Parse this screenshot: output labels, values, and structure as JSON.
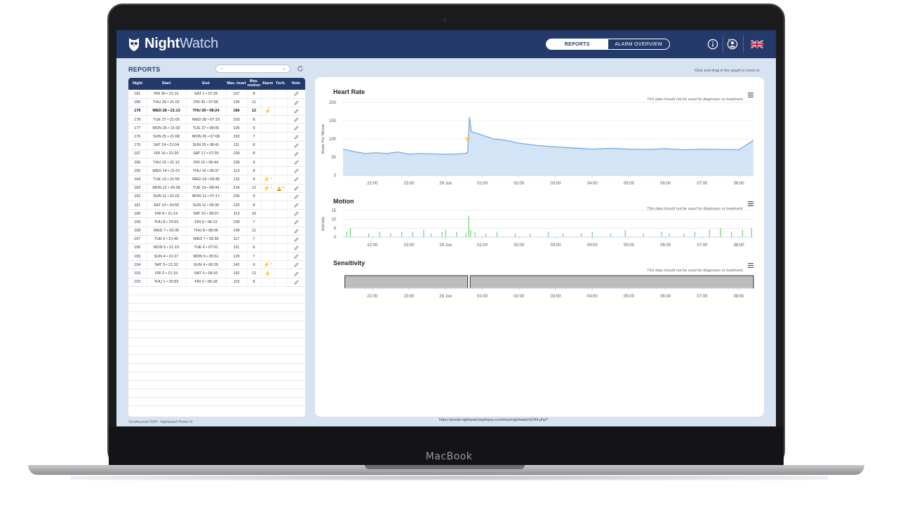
{
  "device": {
    "brand_label": "MacBook"
  },
  "app": {
    "logo_bold": "Night",
    "logo_thin": "Watch",
    "nav": {
      "reports": "REPORTS",
      "alarm_overview": "ALARM OVERVIEW",
      "active": "reports"
    },
    "icons": [
      "info-icon",
      "user-icon",
      "uk-flag-icon"
    ]
  },
  "reports": {
    "title": "REPORTS",
    "select_value": "",
    "columns": [
      "Night",
      "Start",
      "End",
      "Max. heart",
      "Max. motion",
      "Alarm",
      "Tech.",
      "Note"
    ],
    "rows": [
      {
        "night": "181",
        "start": "FRI 30 • 21:10",
        "end": "SAT 1 • 07:25",
        "heart": "107",
        "motion": "8",
        "alarm": "",
        "tech": "",
        "bold": false
      },
      {
        "night": "180",
        "start": "THU 29 • 21:02",
        "end": "FRI 30 • 07:56",
        "heart": "125",
        "motion": "11",
        "alarm": "",
        "tech": "",
        "bold": false
      },
      {
        "night": "179",
        "start": "WED 28 • 21:13",
        "end": "THU 29 • 08:24",
        "heart": "166",
        "motion": "12",
        "alarm": "⚡",
        "alarm_count": "",
        "tech": "",
        "bold": true
      },
      {
        "night": "178",
        "start": "TUE 27 • 21:03",
        "end": "WED 28 • 07:19",
        "heart": "103",
        "motion": "8",
        "alarm": "",
        "tech": "",
        "bold": false
      },
      {
        "night": "177",
        "start": "MON 26 • 21:02",
        "end": "TUE 27 • 08:06",
        "heart": "105",
        "motion": "9",
        "alarm": "",
        "tech": "",
        "bold": false
      },
      {
        "night": "176",
        "start": "SUN 25 • 21:08",
        "end": "MON 26 • 07:08",
        "heart": "103",
        "motion": "7",
        "alarm": "",
        "tech": "",
        "bold": false
      },
      {
        "night": "175",
        "start": "SAT 24 • 21:04",
        "end": "SUN 25 • 08:41",
        "heart": "111",
        "motion": "8",
        "alarm": "",
        "tech": "",
        "bold": false
      },
      {
        "night": "167",
        "start": "FRI 16 • 21:20",
        "end": "SAT 17 • 07:26",
        "heart": "109",
        "motion": "8",
        "alarm": "",
        "tech": "",
        "bold": false
      },
      {
        "night": "166",
        "start": "THU 15 • 21:12",
        "end": "FRI 16 • 06:44",
        "heart": "109",
        "motion": "9",
        "alarm": "",
        "tech": "",
        "bold": false
      },
      {
        "night": "165",
        "start": "WED 14 • 21:01",
        "end": "THU 15 • 06:37",
        "heart": "113",
        "motion": "8",
        "alarm": "",
        "tech": "",
        "bold": false
      },
      {
        "night": "164",
        "start": "TUE 13 • 21:59",
        "end": "WED 14 • 09:45",
        "heart": "122",
        "motion": "9",
        "alarm": "⚡",
        "alarm_count": "1",
        "tech": "",
        "bold": false
      },
      {
        "night": "163",
        "start": "MON 12 • 20:28",
        "end": "TUE 13 • 08:44",
        "heart": "214",
        "motion": "12",
        "alarm": "⚡",
        "alarm_count": "2",
        "tech": "🔔",
        "tech_count": "12",
        "bold": false
      },
      {
        "night": "162",
        "start": "SUN 11 • 21:02",
        "end": "MON 12 • 07:17",
        "heart": "105",
        "motion": "9",
        "alarm": "",
        "tech": "",
        "bold": false
      },
      {
        "night": "161",
        "start": "SAT 10 • 20:55",
        "end": "SUN 11 • 06:30",
        "heart": "120",
        "motion": "8",
        "alarm": "",
        "tech": "",
        "bold": false
      },
      {
        "night": "160",
        "start": "FRI 9 • 21:14",
        "end": "SAT 10 • 08:07",
        "heart": "113",
        "motion": "10",
        "alarm": "",
        "tech": "",
        "bold": false
      },
      {
        "night": "159",
        "start": "THU 8 • 20:53",
        "end": "FRI 9 • 06:13",
        "heart": "109",
        "motion": "7",
        "alarm": "",
        "tech": "",
        "bold": false
      },
      {
        "night": "158",
        "start": "WED 7 • 20:35",
        "end": "THU 8 • 08:06",
        "heart": "109",
        "motion": "11",
        "alarm": "",
        "tech": "",
        "bold": false
      },
      {
        "night": "157",
        "start": "TUE 6 • 21:40",
        "end": "WED 7 • 06:36",
        "heart": "117",
        "motion": "7",
        "alarm": "",
        "tech": "",
        "bold": false
      },
      {
        "night": "156",
        "start": "MON 5 • 21:19",
        "end": "TUE 6 • 07:01",
        "heart": "111",
        "motion": "6",
        "alarm": "",
        "tech": "",
        "bold": false
      },
      {
        "night": "155",
        "start": "SUN 4 • 21:27",
        "end": "MON 5 • 05:51",
        "heart": "125",
        "motion": "7",
        "alarm": "",
        "tech": "",
        "bold": false
      },
      {
        "night": "154",
        "start": "SAT 3 • 21:32",
        "end": "SUN 4 • 06:29",
        "heart": "142",
        "motion": "9",
        "alarm": "⚡",
        "alarm_count": "1",
        "tech": "",
        "bold": false
      },
      {
        "night": "153",
        "start": "FRI 2 • 21:19",
        "end": "SAT 3 • 09:10",
        "heart": "162",
        "motion": "12",
        "alarm": "⚡",
        "alarm_count": "",
        "tech": "",
        "bold": false
      },
      {
        "night": "152",
        "start": "THU 1 • 20:53",
        "end": "FRI 2 • 06:18",
        "heart": "115",
        "motion": "9",
        "alarm": "",
        "tech": "",
        "bold": false
      }
    ],
    "empty_rows": 14
  },
  "footer": {
    "copyright": "©LivAssured 2024 - Nightwatch Portal v3",
    "url": "https://portal.nightwatchepilepsy.com/elas/nightwatch0244.php?"
  },
  "charts_panel": {
    "zoom_hint": "Click and drag in the graph to zoom in",
    "disclaimer": "This data should not be used for diagnoses or treatment."
  },
  "chart_data": [
    {
      "type": "area",
      "title": "Heart Rate",
      "ylabel": "Beats Per Minute",
      "xlabel": "",
      "x_ticks": [
        "22:00",
        "23:00",
        "29 Jun",
        "01:00",
        "02:00",
        "03:00",
        "04:00",
        "05:00",
        "06:00",
        "07:00",
        "08:00"
      ],
      "y_ticks": [
        0,
        50,
        100,
        150,
        200
      ],
      "ylim": [
        0,
        200
      ],
      "x_range_hours": [
        21.2,
        32.4
      ],
      "series": [
        {
          "color": "#7cb0e3",
          "x": [
            21.2,
            21.5,
            21.8,
            22.1,
            22.4,
            22.7,
            23.0,
            23.3,
            23.6,
            23.9,
            24.2,
            24.5,
            24.6,
            24.65,
            24.7,
            25.0,
            25.3,
            25.7,
            26.0,
            26.5,
            27.0,
            27.5,
            28.0,
            28.5,
            29.0,
            29.5,
            30.0,
            30.5,
            31.0,
            31.5,
            32.0,
            32.4
          ],
          "values": [
            72,
            65,
            60,
            62,
            60,
            64,
            58,
            60,
            59,
            58,
            58,
            60,
            62,
            160,
            120,
            110,
            100,
            95,
            88,
            82,
            78,
            75,
            72,
            74,
            72,
            71,
            73,
            70,
            72,
            71,
            70,
            96
          ]
        }
      ],
      "markers": [
        {
          "x": 24.6,
          "label": "⚡"
        }
      ]
    },
    {
      "type": "bar",
      "title": "Motion",
      "ylabel": "Intensity",
      "x_ticks": [
        "22:00",
        "23:00",
        "29 Jun",
        "01:00",
        "02:00",
        "03:00",
        "04:00",
        "05:00",
        "06:00",
        "07:00",
        "08:00"
      ],
      "y_ticks": [
        0,
        5,
        10,
        15
      ],
      "ylim": [
        0,
        15
      ],
      "x_range_hours": [
        21.2,
        32.4
      ],
      "series": [
        {
          "color": "#6ed36e",
          "x": [
            21.3,
            21.4,
            21.9,
            22.2,
            22.5,
            22.8,
            23.1,
            23.4,
            23.6,
            23.9,
            24.0,
            24.3,
            24.55,
            24.63,
            24.68,
            24.8,
            25.1,
            25.4,
            25.9,
            26.3,
            26.8,
            27.2,
            27.7,
            28.0,
            28.5,
            28.9,
            29.4,
            29.9,
            30.1,
            30.5,
            30.8,
            31.2,
            31.5,
            31.8,
            32.1,
            32.35
          ],
          "values": [
            3,
            5,
            2,
            3,
            2,
            3,
            3,
            4,
            2,
            3,
            4,
            3,
            2,
            12,
            4,
            3,
            2,
            3,
            2,
            2,
            3,
            2,
            2,
            3,
            2,
            4,
            2,
            3,
            2,
            2,
            3,
            4,
            5,
            3,
            4,
            5
          ]
        }
      ]
    },
    {
      "type": "area",
      "title": "Sensitivity",
      "ylabel": "",
      "x_ticks": [
        "22:00",
        "23:00",
        "29 Jun",
        "01:00",
        "02:00",
        "03:00",
        "04:00",
        "05:00",
        "06:00",
        "07:00",
        "08:00"
      ],
      "x_range_hours": [
        21.2,
        32.4
      ],
      "series": [
        {
          "color": "#bdbdbd",
          "segments": [
            [
              21.25,
              24.6
            ],
            [
              24.67,
              32.4
            ]
          ]
        }
      ]
    }
  ]
}
